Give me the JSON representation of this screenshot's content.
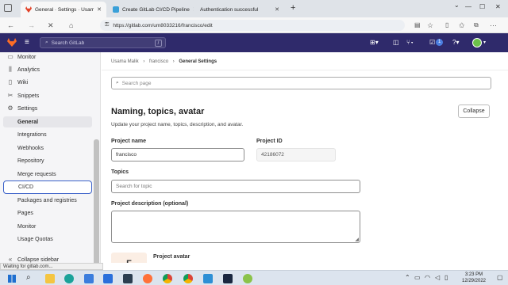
{
  "browser": {
    "tabs": [
      {
        "label": "General · Settings · Usama Mali",
        "active": true
      },
      {
        "label": "Create GitLab CI/CD Pipeline",
        "active": false
      },
      {
        "label": "Authentication successful",
        "active": false
      }
    ],
    "url": "https://gitlab.com/um8033216/francisco/edit",
    "new_tab": "+",
    "win_min": "—",
    "win_max": "☐",
    "win_close": "✕",
    "chevron": "⌄"
  },
  "gitlab_header": {
    "search_placeholder": "Search GitLab",
    "search_shortcut": "/",
    "mr_count": "1"
  },
  "sidebar": {
    "items": [
      {
        "label": "Monitor",
        "icon": "monitor-icon"
      },
      {
        "label": "Analytics",
        "icon": "analytics-icon"
      },
      {
        "label": "Wiki",
        "icon": "book-icon"
      },
      {
        "label": "Snippets",
        "icon": "snippet-icon"
      },
      {
        "label": "Settings",
        "icon": "gear-icon"
      },
      {
        "label": "General"
      },
      {
        "label": "Integrations"
      },
      {
        "label": "Webhooks"
      },
      {
        "label": "Repository"
      },
      {
        "label": "Merge requests"
      },
      {
        "label": "CI/CD"
      },
      {
        "label": "Packages and registries"
      },
      {
        "label": "Pages"
      },
      {
        "label": "Monitor"
      },
      {
        "label": "Usage Quotas"
      }
    ],
    "collapse_label": "Collapse sidebar"
  },
  "breadcrumb": [
    "Usama Malik",
    "francisco",
    "General Settings"
  ],
  "search_page_placeholder": "Search page",
  "section": {
    "title": "Naming, topics, avatar",
    "description": "Update your project name, topics, description, and avatar.",
    "collapse_label": "Collapse"
  },
  "form": {
    "project_name_label": "Project name",
    "project_name_value": "francisco",
    "project_id_label": "Project ID",
    "project_id_value": "42186072",
    "topics_label": "Topics",
    "topics_placeholder": "Search for topic",
    "description_label": "Project description (optional)",
    "avatar_label": "Project avatar",
    "avatar_letter": "F"
  },
  "status_text": "Waiting for gitlab.com...",
  "taskbar": {
    "time": "3:23 PM",
    "date": "12/29/2022"
  }
}
